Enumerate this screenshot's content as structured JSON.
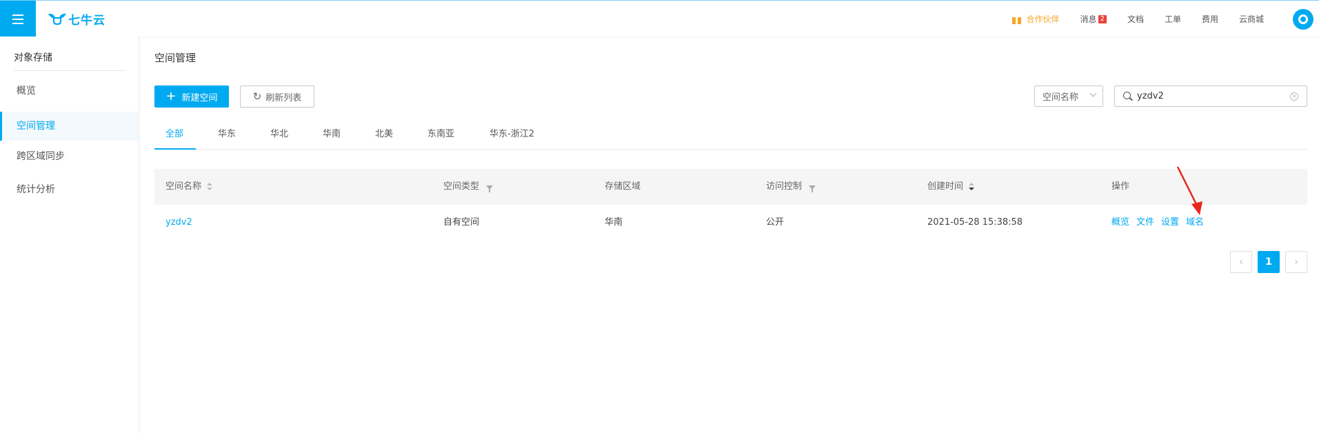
{
  "brand": {
    "logo_text": "七牛云",
    "accent": "#00aaf0"
  },
  "topnav": {
    "partner": "合作伙伴",
    "messages": "消息",
    "message_count": "2",
    "docs": "文档",
    "tickets": "工单",
    "billing": "费用",
    "cloud_mall": "云商城"
  },
  "sidebar": {
    "title": "对象存储",
    "items": [
      {
        "label": "概览"
      },
      {
        "label": "空间管理"
      },
      {
        "label": "跨区域同步"
      },
      {
        "label": "统计分析"
      }
    ]
  },
  "main": {
    "title": "空间管理",
    "new_button": "新建空间",
    "refresh_button": "刷新列表",
    "filter_select": "空间名称",
    "search_value": "yzdv2",
    "tabs": [
      "全部",
      "华东",
      "华北",
      "华南",
      "北美",
      "东南亚",
      "华东-浙江2"
    ],
    "active_tab": "全部"
  },
  "table": {
    "columns": [
      "空间名称",
      "空间类型",
      "存储区域",
      "访问控制",
      "创建时间",
      "操作"
    ],
    "rows": [
      {
        "name": "yzdv2",
        "type": "自有空间",
        "region": "华南",
        "access": "公开",
        "created": "2021-05-28 15:38:58",
        "actions": [
          "概览",
          "文件",
          "设置",
          "域名"
        ]
      }
    ]
  },
  "pagination": {
    "prev": "‹",
    "current": "1",
    "next": "›"
  }
}
